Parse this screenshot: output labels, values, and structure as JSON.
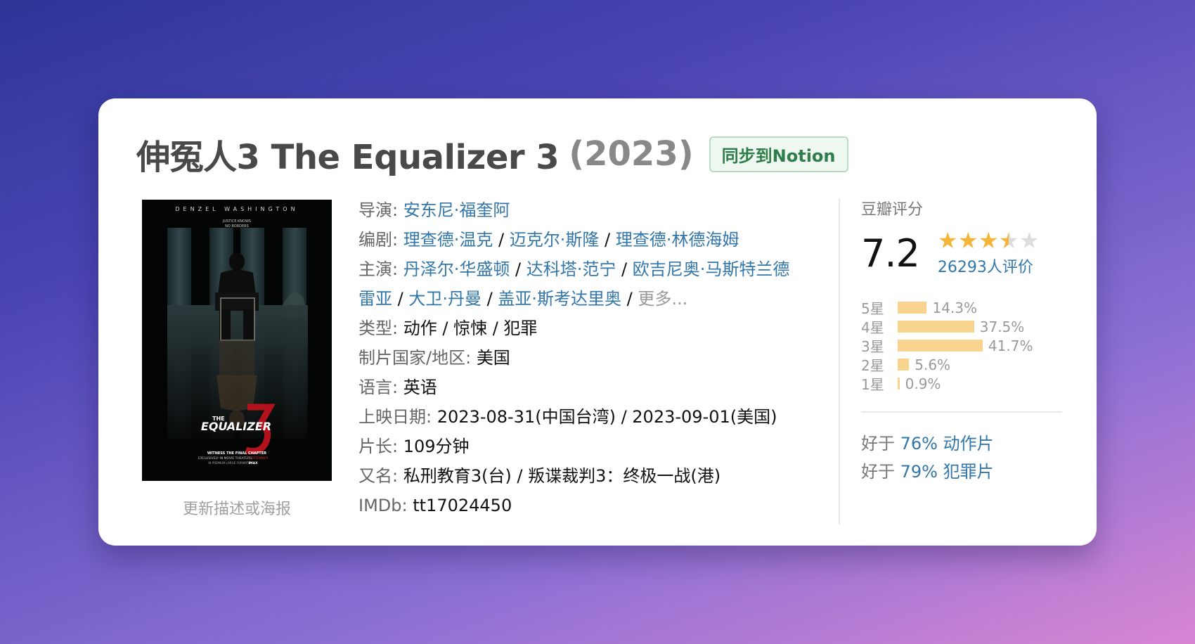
{
  "movie": {
    "title": "伸冤人3 The Equalizer 3",
    "year": "(2023)",
    "sync_button": "同步到Notion"
  },
  "poster": {
    "actor_name": "DENZEL WASHINGTON",
    "tagline_1": "JUSTICE KNOWS",
    "tagline_2": "NO BORDERS",
    "logo_the": "THE",
    "logo_title": "EQUALIZER",
    "footer_1": "WITNESS THE FINAL CHAPTER",
    "footer_2": "EXCLUSIVELY IN MOVIE THEATERS",
    "footer_3": "SEPTEMBER",
    "footer_4": "IN PREMIUM LARGE FORMATS",
    "footer_5": "IMAX",
    "update_link": "更新描述或海报"
  },
  "info": {
    "director_label": "导演:",
    "director": "安东尼·福奎阿",
    "writer_label": "编剧:",
    "writers": [
      "理查德·温克",
      "迈克尔·斯隆",
      "理查德·林德海姆"
    ],
    "cast_label": "主演:",
    "cast": [
      "丹泽尔·华盛顿",
      "达科塔·范宁",
      "欧吉尼奥·马斯特兰德",
      "雷亚",
      "大卫·丹曼",
      "盖亚·斯考达里奥"
    ],
    "more": "更多...",
    "separator": "/",
    "genre_label": "类型:",
    "genres": "动作 / 惊悚 / 犯罪",
    "country_label": "制片国家/地区:",
    "country": "美国",
    "language_label": "语言:",
    "language": "英语",
    "release_label": "上映日期:",
    "release": "2023-08-31(中国台湾) / 2023-09-01(美国)",
    "runtime_label": "片长:",
    "runtime": "109分钟",
    "aka_label": "又名:",
    "aka": "私刑教育3(台) / 叛谍裁判3：终极一战(港)",
    "imdb_label": "IMDb:",
    "imdb": "tt17024450"
  },
  "rating": {
    "label": "豆瓣评分",
    "score": "7.2",
    "stars": 3.5,
    "votes": "26293人评价",
    "distribution": [
      {
        "label": "5星",
        "pct": "14.3%",
        "value": 14.3
      },
      {
        "label": "4星",
        "pct": "37.5%",
        "value": 37.5
      },
      {
        "label": "3星",
        "pct": "41.7%",
        "value": 41.7
      },
      {
        "label": "2星",
        "pct": "5.6%",
        "value": 5.6
      },
      {
        "label": "1星",
        "pct": "0.9%",
        "value": 0.9
      }
    ],
    "better_prefix": "好于",
    "better": [
      {
        "value": "76% 动作片"
      },
      {
        "value": "79% 犯罪片"
      }
    ]
  },
  "colors": {
    "link": "#3377aa",
    "bar": "#f8d48e",
    "star": "#f4b63a",
    "notion_green": "#2f7d4b"
  }
}
